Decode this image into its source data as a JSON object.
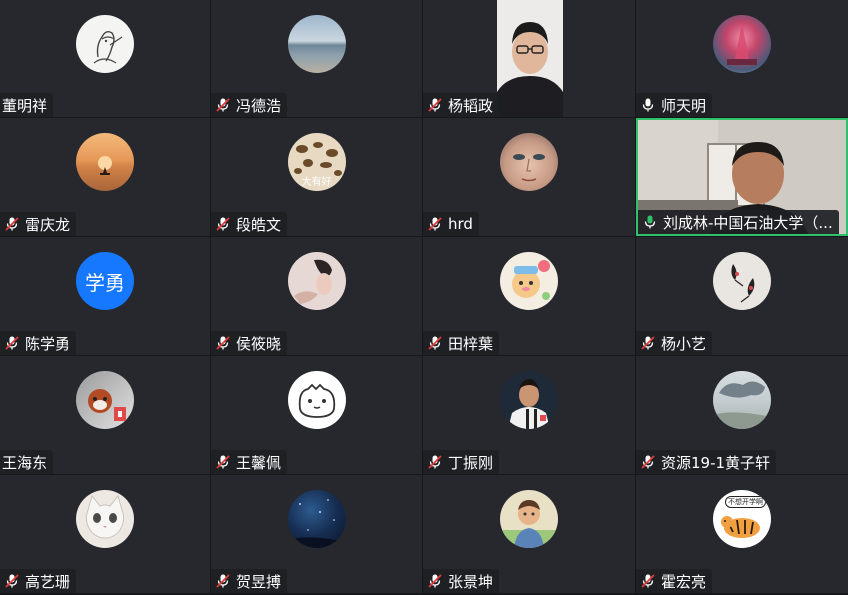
{
  "colors": {
    "tile_bg": "#26282d",
    "gap": "#15171b",
    "muted_mic": "#e23b3b",
    "active_mic": "#2fc26a",
    "speaking_border": "#2fc26a",
    "text_avatar_bg": "#1677ff"
  },
  "participants": [
    {
      "name": "董明祥",
      "mic": "none",
      "avatar": "line-drawing-avatar"
    },
    {
      "name": "冯德浩",
      "mic": "muted",
      "avatar": "seascape-avatar"
    },
    {
      "name": "杨韬政",
      "mic": "muted",
      "avatar": "camera-video"
    },
    {
      "name": "师天明",
      "mic": "on",
      "avatar": "pink-tower-avatar"
    },
    {
      "name": "雷庆龙",
      "mic": "muted",
      "avatar": "sunset-avatar"
    },
    {
      "name": "段皓文",
      "mic": "muted",
      "avatar": "leopard-avatar",
      "avatar_text": "大有好"
    },
    {
      "name": "hrd",
      "mic": "muted",
      "avatar": "face-closeup-avatar"
    },
    {
      "name": "刘成林-中国石油大学（...",
      "mic": "active",
      "avatar": "camera-video",
      "speaking": true
    },
    {
      "name": "陈学勇",
      "mic": "muted",
      "avatar": "text-avatar",
      "avatar_text": "学勇"
    },
    {
      "name": "侯筱晓",
      "mic": "muted",
      "avatar": "portrait-avatar"
    },
    {
      "name": "田梓葉",
      "mic": "muted",
      "avatar": "cartoon-bear-avatar"
    },
    {
      "name": "杨小艺",
      "mic": "muted",
      "avatar": "birds-avatar"
    },
    {
      "name": "王海东",
      "mic": "none",
      "avatar": "red-panda-avatar"
    },
    {
      "name": "王馨佩",
      "mic": "muted",
      "avatar": "line-cat-avatar"
    },
    {
      "name": "丁振刚",
      "mic": "muted",
      "avatar": "footballer-avatar"
    },
    {
      "name": "资源19-1黄子轩",
      "mic": "muted",
      "avatar": "cloud-sky-avatar"
    },
    {
      "name": "高艺珊",
      "mic": "none",
      "avatar": "white-cat-avatar"
    },
    {
      "name": "贺昱搏",
      "mic": "muted",
      "avatar": "night-sky-avatar"
    },
    {
      "name": "张景坤",
      "mic": "muted",
      "avatar": "cartoon-man-avatar"
    },
    {
      "name": "霍宏亮",
      "mic": "muted",
      "avatar": "tiger-avatar",
      "avatar_text": "不想开学啊"
    }
  ]
}
